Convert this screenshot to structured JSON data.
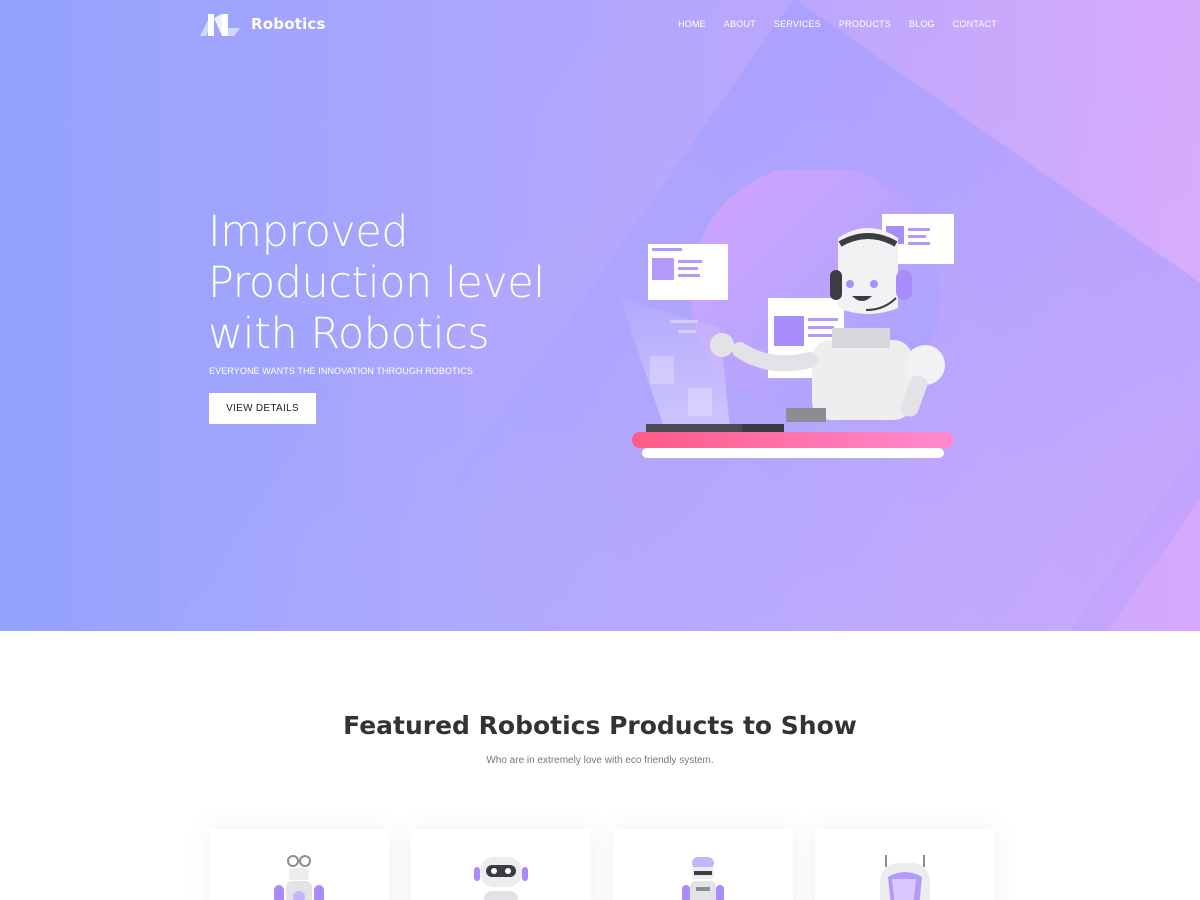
{
  "brand": {
    "name": "Robotics",
    "logo_icon": "logo-icon"
  },
  "nav": {
    "items": [
      {
        "label": "HOME"
      },
      {
        "label": "ABOUT"
      },
      {
        "label": "SERVICES"
      },
      {
        "label": "PRODUCTS"
      },
      {
        "label": "BLOG"
      },
      {
        "label": "CONTACT"
      }
    ]
  },
  "hero": {
    "title_lines": [
      "Improved",
      "Production level",
      "with Robotics"
    ],
    "subtitle": "EVERYONE WANTS THE INNOVATION THROUGH ROBOTICS",
    "button_label": "VIEW DETAILS",
    "illustration_icon": "robot-support-illustration"
  },
  "featured": {
    "title": "Featured Robotics Products to Show",
    "subtitle": "Who are in extremely love with eco friendly system.",
    "cards": [
      {
        "icon": "robot-antenna-icon"
      },
      {
        "icon": "robot-visor-icon"
      },
      {
        "icon": "robot-small-icon"
      },
      {
        "icon": "robot-capsule-icon"
      }
    ]
  },
  "colors": {
    "hero_gradient_start": "#93a3fd",
    "hero_gradient_end": "#d6a8fc",
    "accent_pink": "#ff5f8f",
    "accent_purple": "#a98bfa"
  }
}
